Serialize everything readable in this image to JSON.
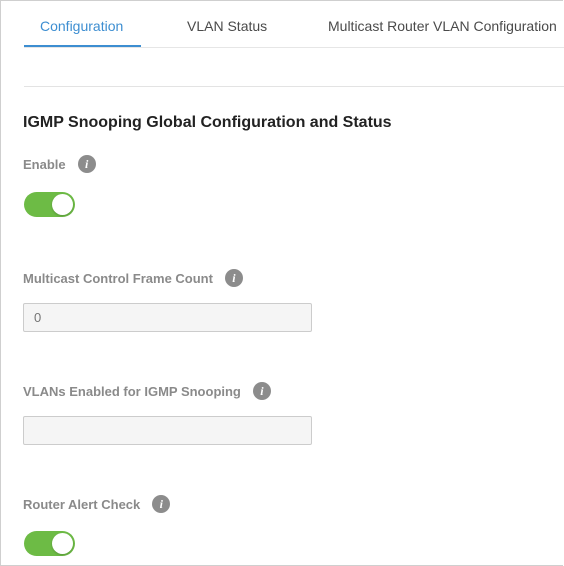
{
  "tabs": [
    {
      "label": "Configuration",
      "active": true
    },
    {
      "label": "VLAN Status",
      "active": false
    },
    {
      "label": "Multicast Router VLAN Configuration",
      "active": false
    }
  ],
  "section": {
    "title": "IGMP Snooping Global Configuration and Status"
  },
  "fields": {
    "enable": {
      "label": "Enable",
      "value": true,
      "info_icon": "info-icon"
    },
    "frame_count": {
      "label": "Multicast Control Frame Count",
      "placeholder": "0",
      "value": "",
      "info_icon": "info-icon"
    },
    "vlans_enabled": {
      "label": "VLANs Enabled for IGMP Snooping",
      "value": "",
      "info_icon": "info-icon"
    },
    "router_alert": {
      "label": "Router Alert Check",
      "value": true,
      "info_icon": "info-icon"
    }
  },
  "colors": {
    "accent": "#3d8ed1",
    "toggle_on": "#6dbb45",
    "info_icon": "#8c8c8c"
  }
}
